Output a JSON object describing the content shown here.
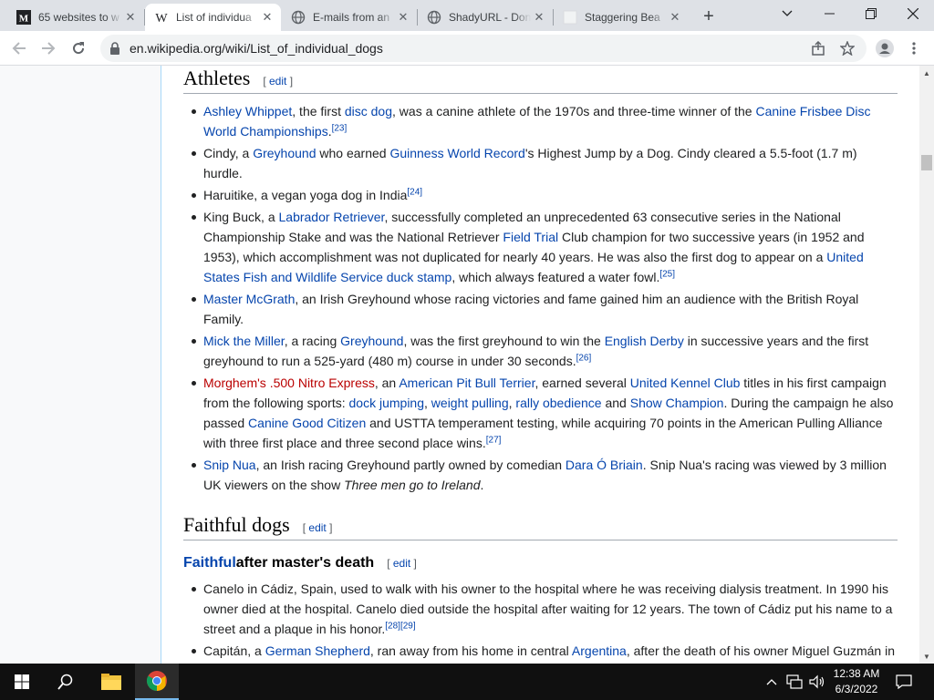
{
  "browser": {
    "tabs": [
      {
        "title": "65 websites to w",
        "close": "✕"
      },
      {
        "title": "List of individua",
        "close": "✕"
      },
      {
        "title": "E-mails from an",
        "close": "✕"
      },
      {
        "title": "ShadyURL - Don",
        "close": "✕"
      },
      {
        "title": "Staggering Bea",
        "close": "✕"
      }
    ],
    "new_tab": "+",
    "url": "en.wikipedia.org/wiki/List_of_individual_dogs"
  },
  "article": {
    "athletes": {
      "title": "Athletes",
      "edit": "edit",
      "items": [
        {
          "p1": "Ashley Whippet",
          "t1": ", the first ",
          "p2": "disc dog",
          "t2": ", was a canine athlete of the 1970s and three-time winner of the ",
          "p3": "Canine Frisbee Disc World Championships",
          "t3": ".",
          "ref": "[23]"
        },
        {
          "t0": "Cindy, a ",
          "p1": "Greyhound",
          "t1": " who earned ",
          "p2": "Guinness World Record",
          "t2": "'s Highest Jump by a Dog. Cindy cleared a 5.5-foot (1.7 m) hurdle."
        },
        {
          "t0": "Haruitike, a vegan yoga dog in India",
          "ref": "[24]"
        },
        {
          "t0": "King Buck, a ",
          "p1": "Labrador Retriever",
          "t1": ", successfully completed an unprecedented 63 consecutive series in the National Championship Stake and was the National Retriever ",
          "p2": "Field Trial",
          "t2": " Club champion for two successive years (in 1952 and 1953), which accomplishment was not duplicated for nearly 40 years. He was also the first dog to appear on a ",
          "p3": "United States Fish and Wildlife Service duck stamp",
          "t3": ", which always featured a water fowl.",
          "ref": "[25]"
        },
        {
          "p1": "Master McGrath",
          "t1": ", an Irish Greyhound whose racing victories and fame gained him an audience with the British Royal Family."
        },
        {
          "p1": "Mick the Miller",
          "t1": ", a racing ",
          "p2": "Greyhound",
          "t2": ", was the first greyhound to win the ",
          "p3": "English Derby",
          "t3": " in successive years and the first greyhound to run a 525-yard (480 m) course in under 30 seconds.",
          "ref": "[26]"
        },
        {
          "p1": "Morghem's .500 Nitro Express",
          "t1": ", an ",
          "p2": "American Pit Bull Terrier",
          "t2": ", earned several ",
          "p3": "United Kennel Club",
          "t3": " titles in his first campaign from the following sports: ",
          "p4": "dock jumping",
          "t4": ", ",
          "p5": "weight pulling",
          "t5": ", ",
          "p6": "rally obedience",
          "t6": " and ",
          "p7": "Show Champion",
          "t7": ". During the campaign he also passed ",
          "p8": "Canine Good Citizen",
          "t8": " and USTTA temperament testing, while acquiring 70 points in the American Pulling Alliance with three first place and three second place wins.",
          "ref": "[27]"
        },
        {
          "p1": "Snip Nua",
          "t1": ", an Irish racing Greyhound partly owned by comedian ",
          "p2": "Dara Ó Briain",
          "t2": ". Snip Nua's racing was viewed by 3 million UK viewers on the show ",
          "italic": "Three men go to Ireland",
          "t3": "."
        }
      ]
    },
    "faithful": {
      "title": "Faithful dogs",
      "edit": "edit",
      "sub_link": "Faithful",
      "sub_rest": " after master's death",
      "sub_edit": "edit",
      "items": [
        {
          "t0": "Canelo in Cádiz, Spain, used to walk with his owner to the hospital where he was receiving dialysis treatment. In 1990 his owner died at the hospital. Canelo died outside the hospital after waiting for 12 years. The town of Cádiz put his name to a street and a plaque in his honor.",
          "ref1": "[28]",
          "ref2": "[29]"
        },
        {
          "t0": "Capitán, a ",
          "p1": "German Shepherd",
          "t1": ", ran away from his home in central ",
          "p2": "Argentina",
          "t2": ", after the death of his owner Miguel Guzmán in"
        }
      ]
    }
  },
  "taskbar": {
    "time": "12:38 AM",
    "date": "6/3/2022"
  }
}
